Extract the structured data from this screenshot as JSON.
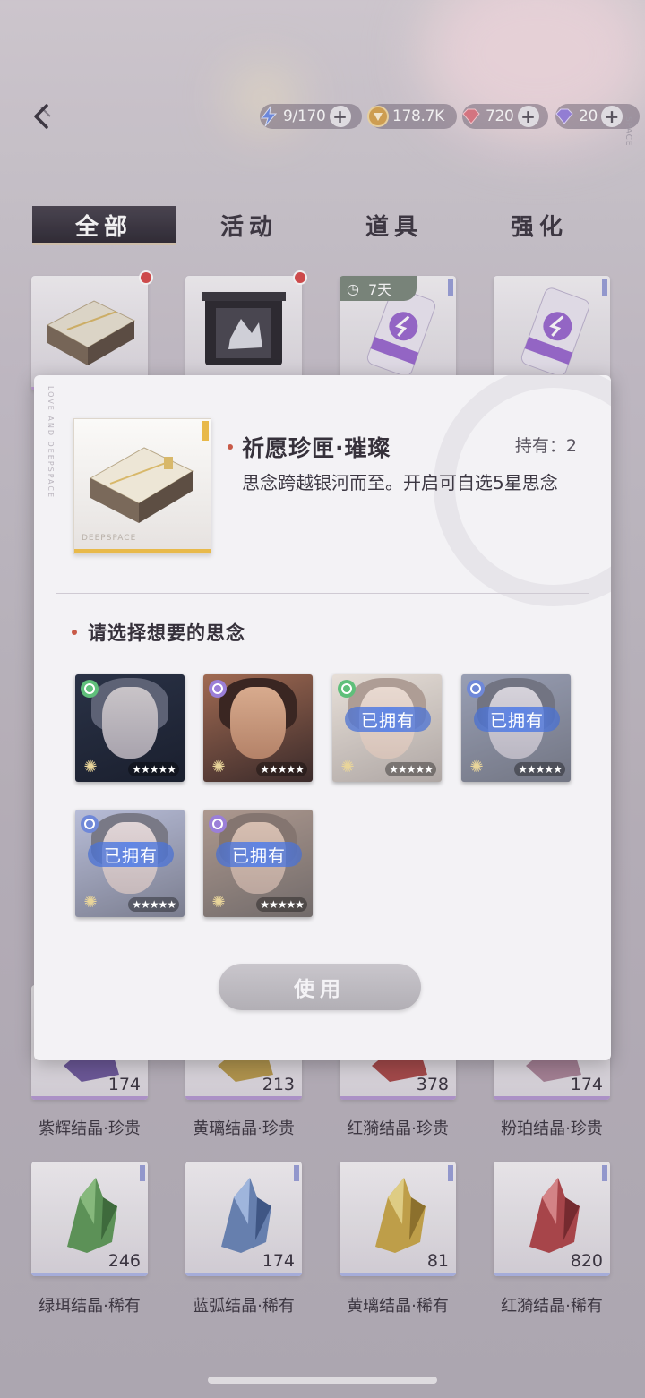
{
  "currencies": [
    {
      "name": "stamina",
      "value": "9/170",
      "icon": "lightning-icon"
    },
    {
      "name": "gold",
      "value": "178.7K",
      "icon": "gold-coin-icon"
    },
    {
      "name": "red-diamond",
      "value": "720",
      "icon": "red-diamond-icon"
    },
    {
      "name": "purple-diamond",
      "value": "20",
      "icon": "purple-diamond-icon"
    }
  ],
  "side_text": "SPACE",
  "tabs": [
    "全部",
    "活动",
    "道具",
    "强化"
  ],
  "top_items": [
    {
      "name": "wish-box",
      "timer": ""
    },
    {
      "name": "black-box",
      "timer": ""
    },
    {
      "name": "energy-drink-timed",
      "timer": "7天"
    },
    {
      "name": "energy-drink",
      "timer": ""
    }
  ],
  "crystal_rows": [
    [
      {
        "label": "紫辉结晶·珍贵",
        "count": "174"
      },
      {
        "label": "黄璃结晶·珍贵",
        "count": "213"
      },
      {
        "label": "红漪结晶·珍贵",
        "count": "378"
      },
      {
        "label": "粉珀结晶·珍贵",
        "count": "174"
      }
    ],
    [
      {
        "label": "绿珥结晶·稀有",
        "count": "246"
      },
      {
        "label": "蓝弧结晶·稀有",
        "count": "174"
      },
      {
        "label": "黄璃结晶·稀有",
        "count": "81"
      },
      {
        "label": "红漪结晶·稀有",
        "count": "820"
      }
    ]
  ],
  "modal": {
    "title": "祈愿珍匣·璀璨",
    "owned_label": "持有：2",
    "description": "思念跨越银河而至。开启可自选5星思念",
    "watermark": "DEEPSPACE",
    "edge_text": "LOVE AND DEEPSPACE",
    "select_prompt": "请选择想要的思念",
    "owned_badge": "已拥有",
    "stars": "★★★★★",
    "cards": [
      {
        "attr_color": "#5fbf7a",
        "owned": false
      },
      {
        "attr_color": "#9b7fd8",
        "owned": false
      },
      {
        "attr_color": "#5fbf7a",
        "owned": true
      },
      {
        "attr_color": "#6f88d8",
        "owned": true
      },
      {
        "attr_color": "#6f88d8",
        "owned": true
      },
      {
        "attr_color": "#9b7fd8",
        "owned": true
      }
    ],
    "use_button": "使用"
  }
}
